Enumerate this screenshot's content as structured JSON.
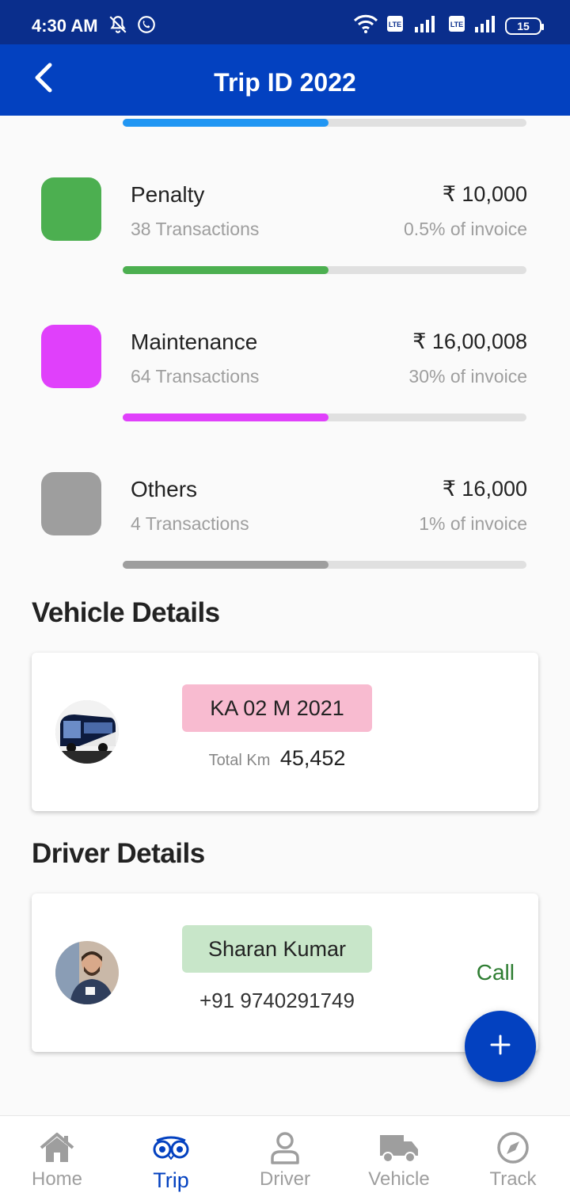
{
  "status": {
    "time": "4:30 AM",
    "battery": "15"
  },
  "header": {
    "title": "Trip ID 2022"
  },
  "top_progress": 0.51,
  "categories": [
    {
      "name": "Penalty",
      "transactions": "38 Transactions",
      "amount": "₹ 10,000",
      "percent": "0.5% of invoice",
      "color": "#4caf50",
      "bar_fill": 0.51
    },
    {
      "name": "Maintenance",
      "transactions": "64 Transactions",
      "amount": "₹ 16,00,008",
      "percent": "30% of invoice",
      "color": "#e040fb",
      "bar_fill": 0.51
    },
    {
      "name": "Others",
      "transactions": "4 Transactions",
      "amount": "₹ 16,000",
      "percent": "1% of invoice",
      "color": "#9e9e9e",
      "bar_fill": 0.51
    }
  ],
  "vehicle": {
    "section_title": "Vehicle Details",
    "plate": "KA 02 M 2021",
    "plate_color": "#f8bbd0",
    "km_label": "Total Km",
    "km_value": "45,452"
  },
  "driver": {
    "section_title": "Driver Details",
    "name": "Sharan Kumar",
    "name_color": "#c8e6c9",
    "phone": "+91 9740291749",
    "call_label": "Call"
  },
  "fab": {
    "icon": "plus-icon"
  },
  "nav": [
    {
      "label": "Home",
      "icon": "home-icon"
    },
    {
      "label": "Trip",
      "icon": "trip-icon",
      "active": true
    },
    {
      "label": "Driver",
      "icon": "person-icon"
    },
    {
      "label": "Vehicle",
      "icon": "truck-icon"
    },
    {
      "label": "Track",
      "icon": "compass-icon"
    }
  ],
  "colors": {
    "statusbar": "#0a2e8c",
    "appbar": "#0341c0",
    "accent": "#2196f3",
    "call": "#2e7d32"
  }
}
